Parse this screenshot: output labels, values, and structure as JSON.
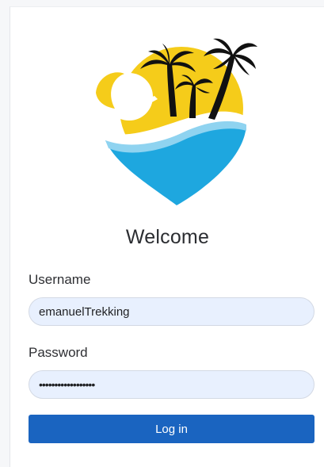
{
  "login": {
    "title": "Welcome",
    "username_label": "Username",
    "username_value": "emanuelTrekking",
    "password_label": "Password",
    "password_value": "••••••••••••••••••",
    "login_button": "Log in"
  },
  "colors": {
    "primary_button": "#1a64c0",
    "input_background": "#e8f0fe",
    "logo_sun": "#f5cc1a",
    "logo_water": "#1ea7df"
  }
}
